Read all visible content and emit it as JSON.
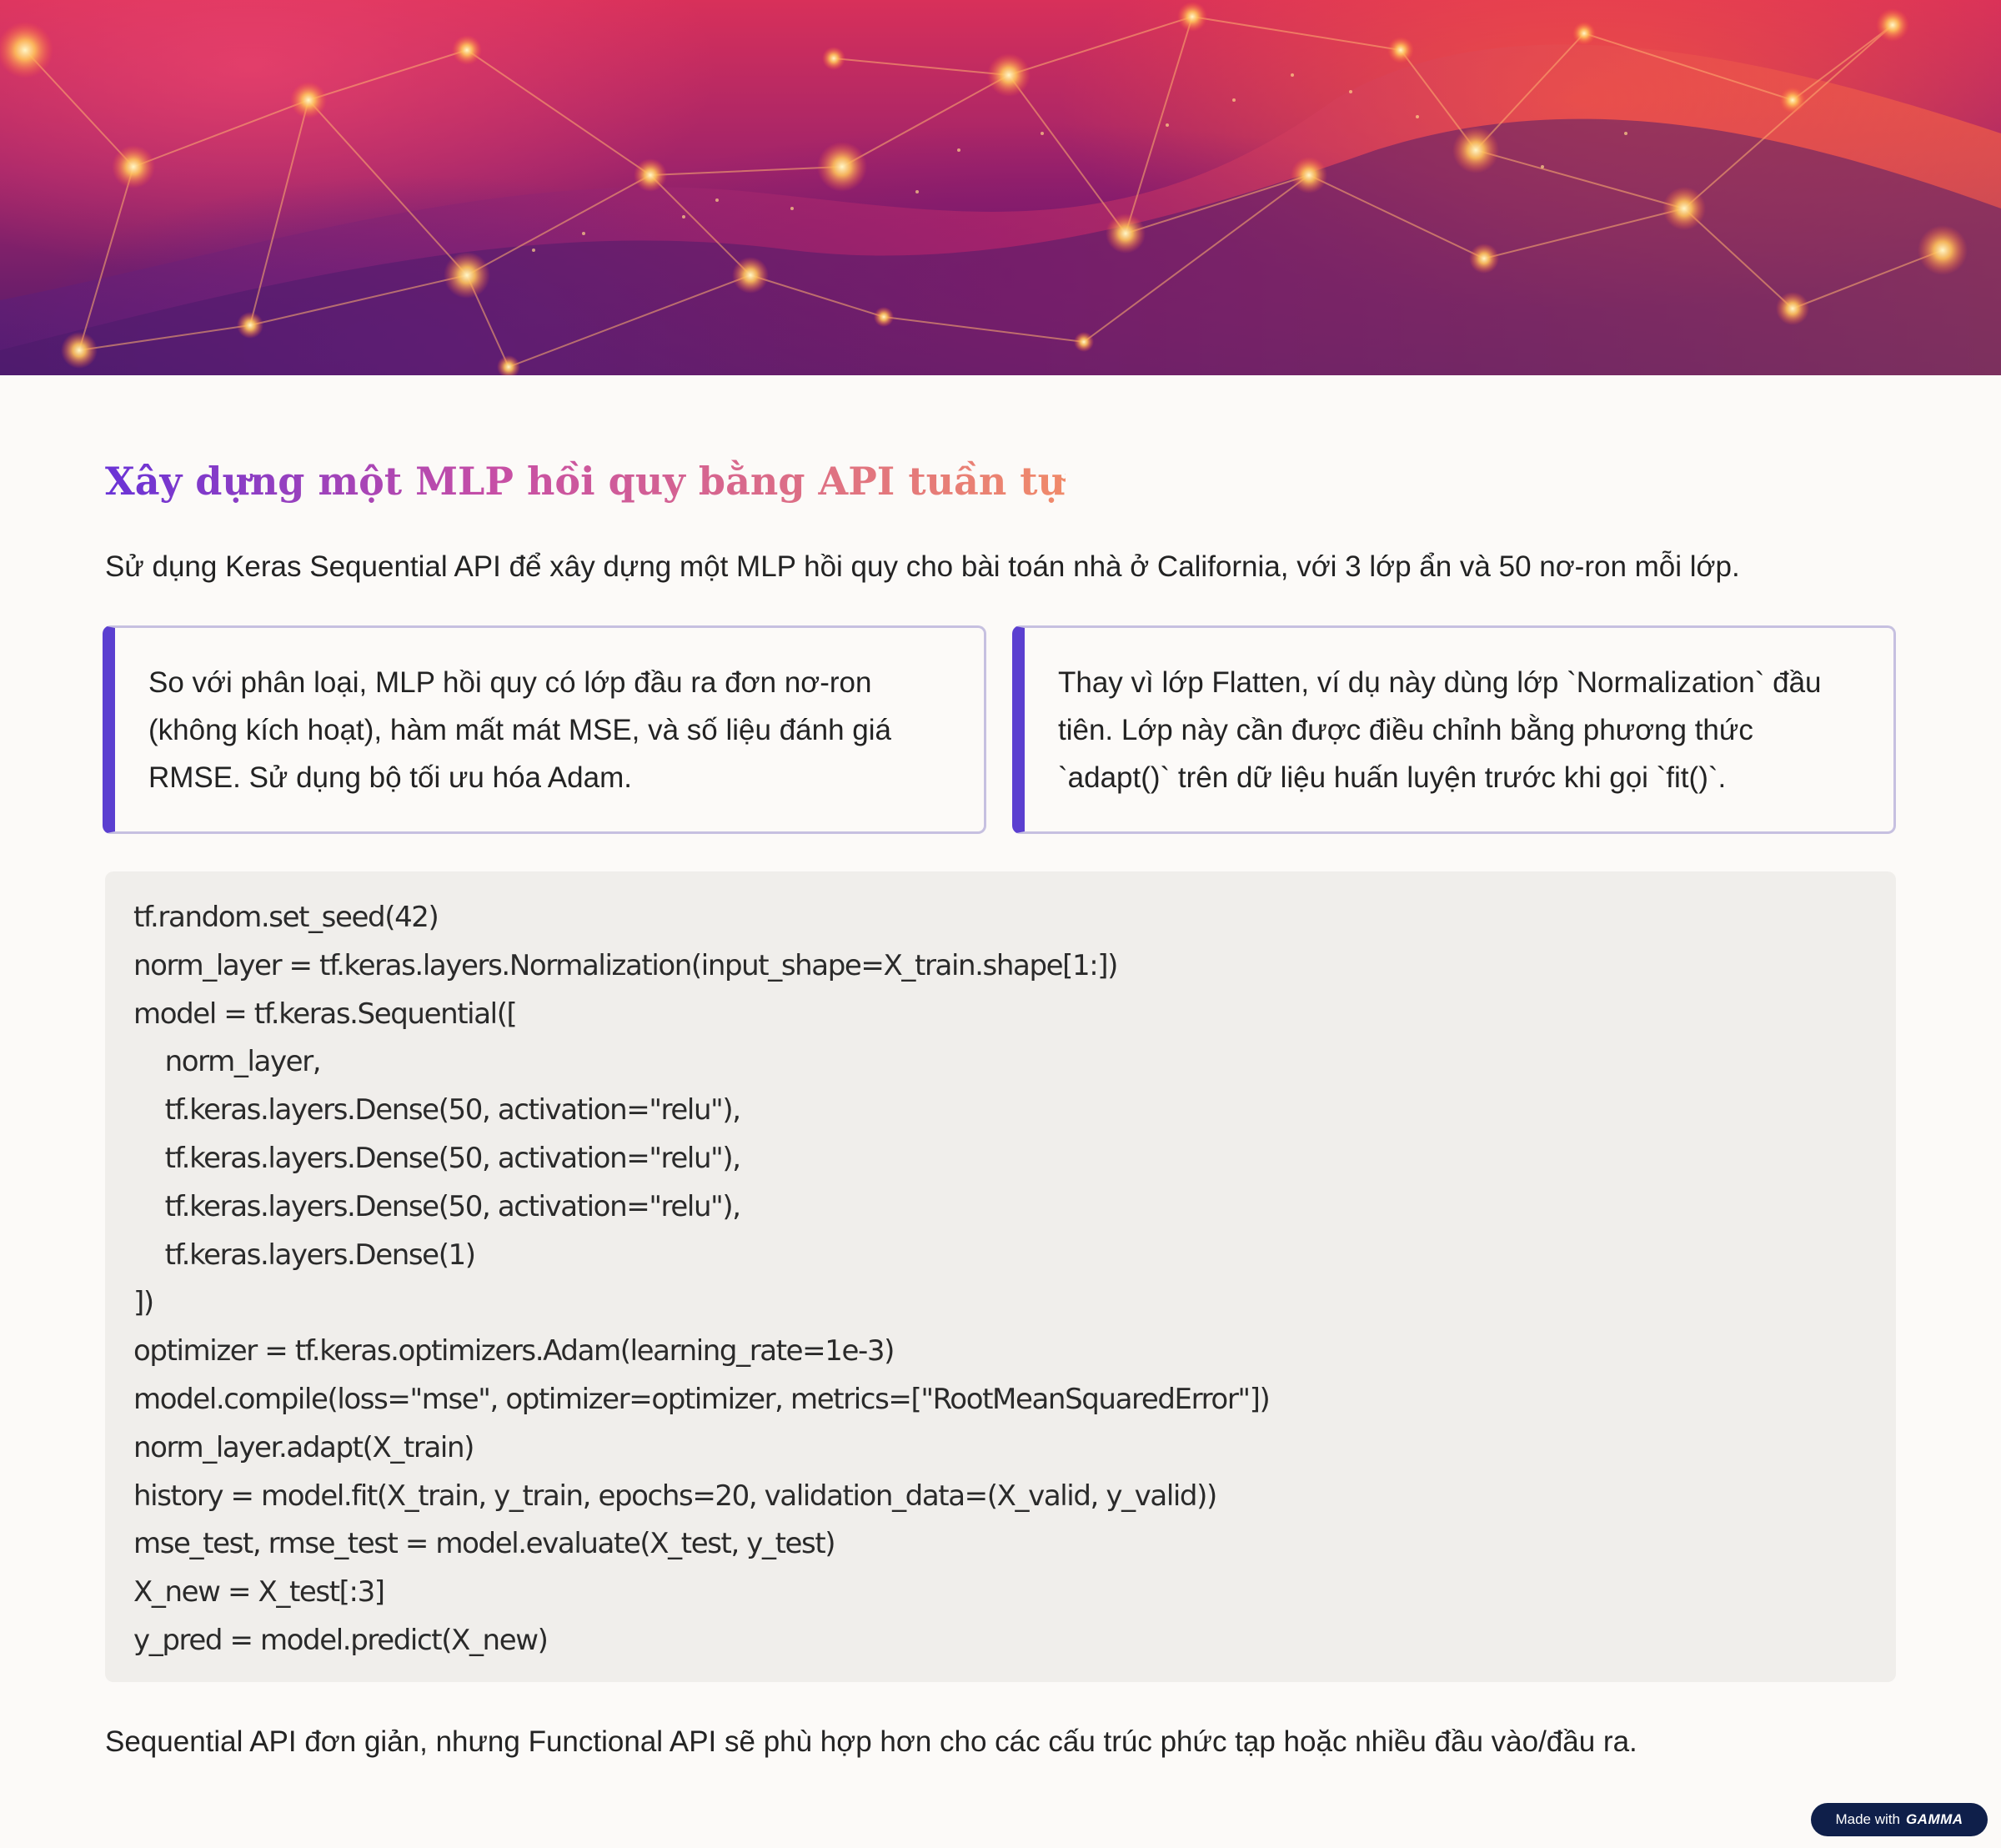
{
  "hero": {
    "image": "abstract-neural-network-banner",
    "colors": {
      "primary": "#d8305a",
      "glow": "#ffd070",
      "deep": "#4a1a6a"
    }
  },
  "title": "Xây dựng một MLP hồi quy bằng API tuần tự",
  "intro": "Sử dụng Keras Sequential API để xây dựng một MLP hồi quy cho bài toán nhà ở California, với 3 lớp ẩn và 50 nơ-ron mỗi lớp.",
  "callouts": [
    {
      "text": "So với phân loại, MLP hồi quy có lớp đầu ra đơn nơ-ron (không kích hoạt), hàm mất mát MSE, và số liệu đánh giá RMSE. Sử dụng bộ tối ưu hóa Adam."
    },
    {
      "text": "Thay vì lớp Flatten, ví dụ này dùng lớp `Normalization` đầu tiên. Lớp này cần được điều chỉnh bằng phương thức `adapt()` trên dữ liệu huấn luyện trước khi gọi `fit()`."
    }
  ],
  "code_lines": [
    "tf.random.set_seed(42)",
    "norm_layer = tf.keras.layers.Normalization(input_shape=X_train.shape[1:])",
    "model = tf.keras.Sequential([",
    "    norm_layer,",
    "    tf.keras.layers.Dense(50, activation=\"relu\"),",
    "    tf.keras.layers.Dense(50, activation=\"relu\"),",
    "    tf.keras.layers.Dense(50, activation=\"relu\"),",
    "    tf.keras.layers.Dense(1)",
    "])",
    "optimizer = tf.keras.optimizers.Adam(learning_rate=1e-3)",
    "model.compile(loss=\"mse\", optimizer=optimizer, metrics=[\"RootMeanSquaredError\"])",
    "norm_layer.adapt(X_train)",
    "history = model.fit(X_train, y_train, epochs=20, validation_data=(X_valid, y_valid))",
    "mse_test, rmse_test = model.evaluate(X_test, y_test)",
    "X_new = X_test[:3]",
    "y_pred = model.predict(X_new)"
  ],
  "footer_text": "Sequential API đơn giản, nhưng Functional API sẽ phù hợp hơn cho các cấu trúc phức tạp hoặc nhiều đầu vào/đầu ra.",
  "badge": {
    "prefix": "Made with",
    "brand": "GAMMA"
  },
  "theme": {
    "accent": "#5b3fd0",
    "callout_border": "#c6c0e0",
    "code_bg": "#f0eeeb",
    "badge_bg": "#0f1f4a"
  }
}
